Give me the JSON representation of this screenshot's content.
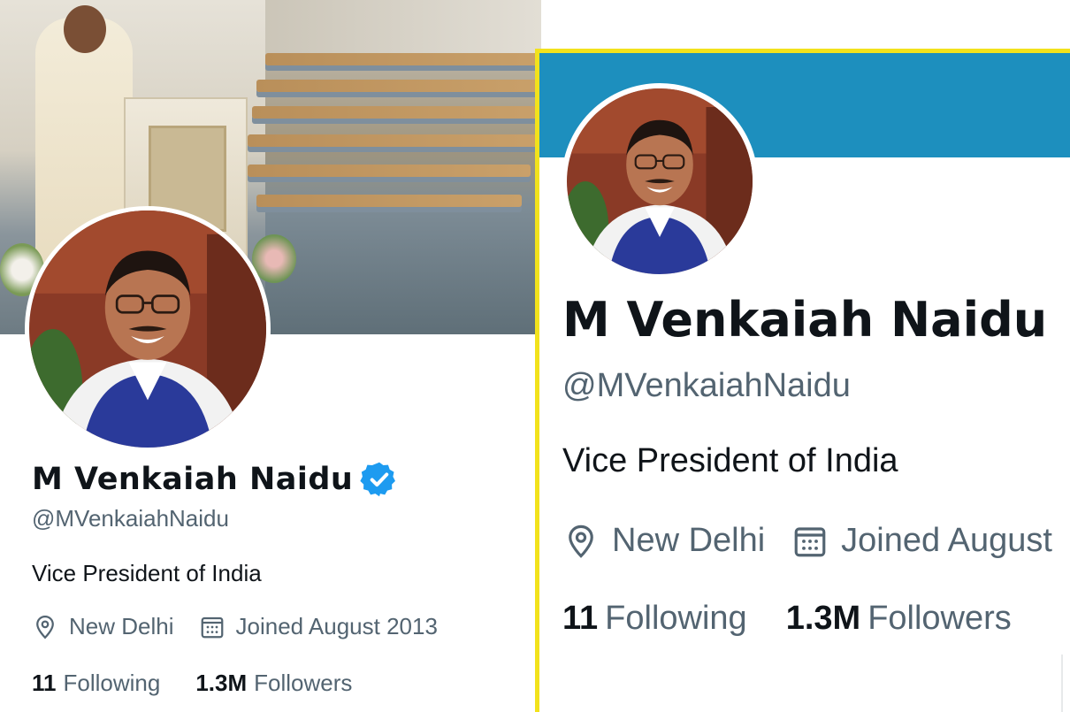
{
  "left_profile": {
    "name": "M Venkaiah Naidu",
    "handle": "@MVenkaiahNaidu",
    "bio": "Vice President of India",
    "location": "New Delhi",
    "joined": "Joined August 2013",
    "following_count": "11",
    "following_label": "Following",
    "followers_count": "1.3M",
    "followers_label": "Followers",
    "verified_badge_color": "#1d9bf0"
  },
  "right_profile": {
    "name": "M Venkaiah Naidu",
    "handle": "@MVenkaiahNaidu",
    "bio": "Vice President of India",
    "location": "New Delhi",
    "joined": "Joined August",
    "following_count": "11",
    "following_label": "Following",
    "followers_count": "1.3M",
    "followers_label": "Followers",
    "banner_color": "#1d8fbe",
    "highlight_border_color": "#f2e21c"
  },
  "icons": {
    "location": "location-pin-icon",
    "calendar": "calendar-icon",
    "verified": "verified-badge-icon"
  }
}
